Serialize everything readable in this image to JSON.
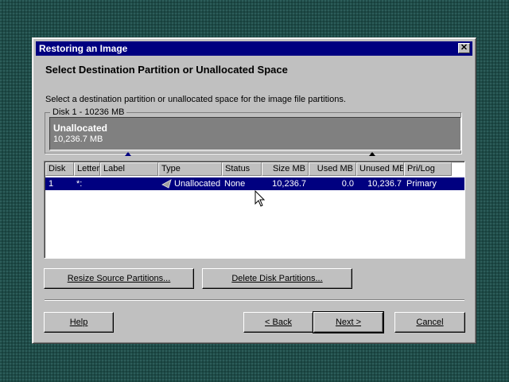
{
  "window": {
    "title": "Restoring an Image",
    "close_glyph": "✕"
  },
  "heading": "Select Destination Partition or Unallocated Space",
  "instruction": "Select a destination partition or unallocated space for the image file partitions.",
  "disk": {
    "label": "Disk 1 - 10236  MB",
    "bar_name": "Unallocated",
    "bar_size": "10,236.7 MB"
  },
  "table": {
    "columns": [
      "Disk",
      "Letter",
      "Label",
      "Type",
      "Status",
      "Size MB",
      "Used MB",
      "Unused MB",
      "Pri/Log"
    ],
    "rows": [
      {
        "disk": "1",
        "letter": "*:",
        "label": "",
        "type": "Unallocated",
        "status": "None",
        "size_mb": "10,236.7",
        "used_mb": "0.0",
        "unused_mb": "10,236.7",
        "pri_log": "Primary",
        "selected": true
      }
    ]
  },
  "buttons": {
    "resize": "Resize Source Partitions...",
    "delete": "Delete Disk Partitions...",
    "help": "Help",
    "back": "< Back",
    "next": "Next >",
    "cancel": "Cancel"
  },
  "colors": {
    "selection": "#000080",
    "titlebar": "#000080",
    "dialog_face": "#c0c0c0",
    "desktop": "#1f4a47"
  },
  "icons": [
    "close-icon",
    "partition-type-icon",
    "mouse-pointer-icon"
  ]
}
